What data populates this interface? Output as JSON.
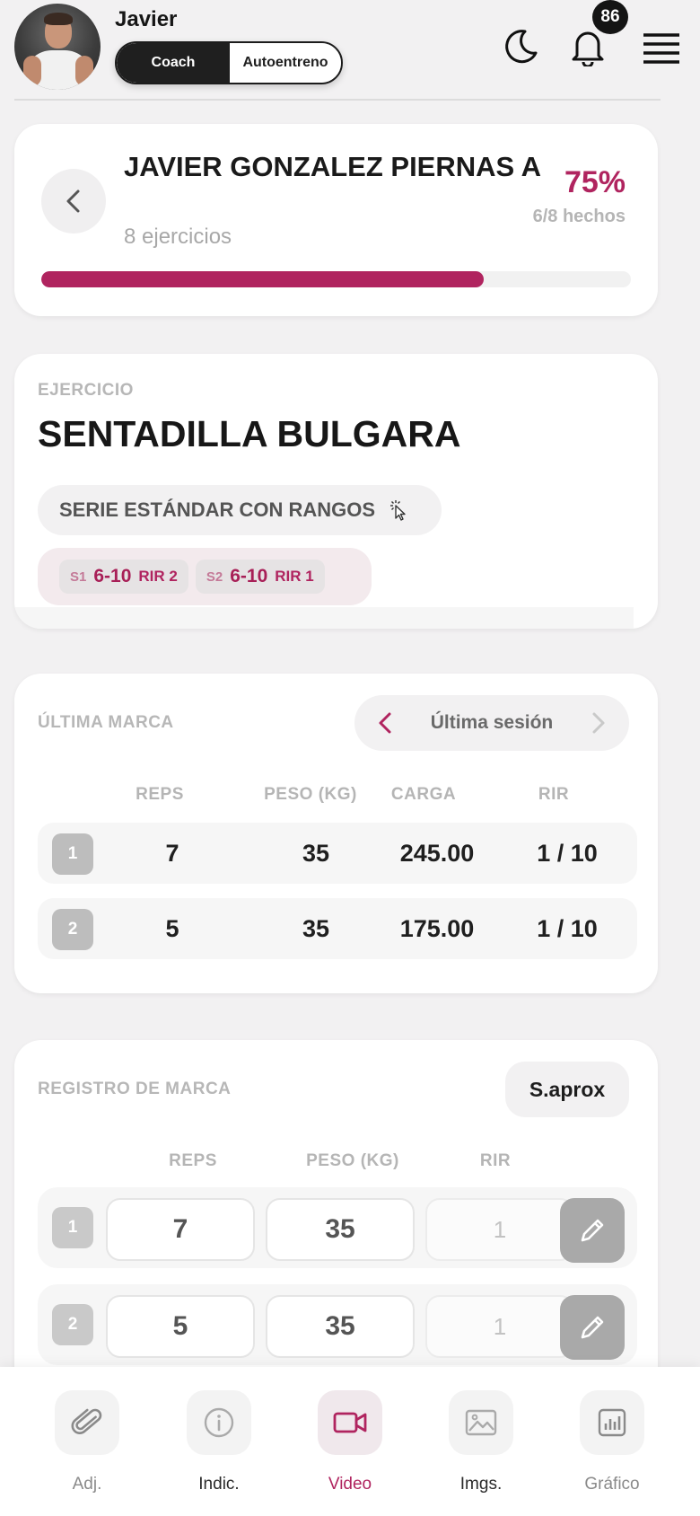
{
  "header": {
    "user_name": "Javier",
    "mode_active": "Coach",
    "mode_other": "Autoentreno",
    "notification_count": "86",
    "icons": {
      "theme": "moon-icon",
      "notifications": "bell-icon",
      "menu": "hamburger-menu-icon"
    }
  },
  "workout": {
    "title": "JAVIER GONZALEZ PIERNAS A",
    "subtitle": "8 ejercicios",
    "percent_label": "75%",
    "done_label": "6/8 hechos",
    "progress": 0.75
  },
  "exercise": {
    "section_label": "EJERCICIO",
    "name": "SENTADILLA BULGARA",
    "series_type": "SERIE ESTÁNDAR CON RANGOS",
    "sets": [
      {
        "tag": "S1",
        "range": "6-10",
        "rir": "RIR 2"
      },
      {
        "tag": "S2",
        "range": "6-10",
        "rir": "RIR 1"
      }
    ]
  },
  "last_mark": {
    "section_label": "ÚLTIMA MARCA",
    "session_label": "Última sesión",
    "columns": [
      "REPS",
      "PESO (KG)",
      "CARGA",
      "RIR"
    ],
    "rows": [
      {
        "num": "1",
        "reps": "7",
        "peso": "35",
        "carga": "245.00",
        "rir": "1 / 10"
      },
      {
        "num": "2",
        "reps": "5",
        "peso": "35",
        "carga": "175.00",
        "rir": "1 / 10"
      }
    ]
  },
  "register": {
    "section_label": "REGISTRO DE MARCA",
    "saprox_label": "S.aprox",
    "columns": [
      "REPS",
      "PESO (KG)",
      "RIR"
    ],
    "rows": [
      {
        "num": "1",
        "reps": "7",
        "peso": "35",
        "rir": "1"
      },
      {
        "num": "2",
        "reps": "5",
        "peso": "35",
        "rir": "1"
      }
    ]
  },
  "bottom_nav": [
    {
      "label": "Adj.",
      "icon": "paperclip-icon"
    },
    {
      "label": "Indic.",
      "icon": "info-icon"
    },
    {
      "label": "Video",
      "icon": "video-camera-icon"
    },
    {
      "label": "Imgs.",
      "icon": "image-icon"
    },
    {
      "label": "Gráfico",
      "icon": "bar-chart-icon"
    }
  ],
  "colors": {
    "accent": "#b0245f",
    "background": "#f2f1f2",
    "card": "#ffffff"
  }
}
